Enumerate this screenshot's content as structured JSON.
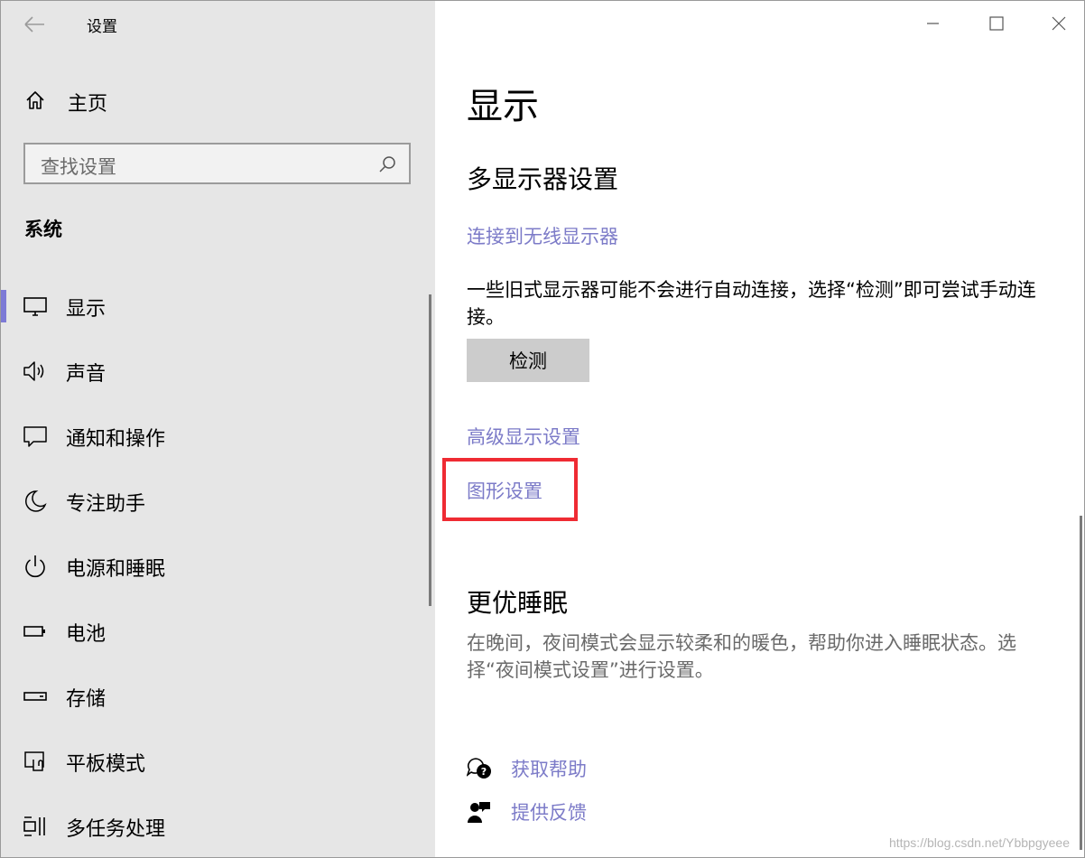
{
  "window": {
    "title": "设置"
  },
  "sidebar": {
    "home_label": "主页",
    "search_placeholder": "查找设置",
    "section_title": "系统",
    "items": [
      {
        "label": "显示",
        "icon": "monitor-icon",
        "active": true
      },
      {
        "label": "声音",
        "icon": "speaker-icon"
      },
      {
        "label": "通知和操作",
        "icon": "message-icon"
      },
      {
        "label": "专注助手",
        "icon": "moon-icon"
      },
      {
        "label": "电源和睡眠",
        "icon": "power-icon"
      },
      {
        "label": "电池",
        "icon": "battery-icon"
      },
      {
        "label": "存储",
        "icon": "storage-icon"
      },
      {
        "label": "平板模式",
        "icon": "tablet-mode-icon"
      },
      {
        "label": "多任务处理",
        "icon": "multitask-icon"
      }
    ]
  },
  "main": {
    "page_title": "显示",
    "multi_display": {
      "heading": "多显示器设置",
      "wireless_link": "连接到无线显示器",
      "description": "一些旧式显示器可能不会进行自动连接，选择“检测”即可尝试手动连接。",
      "detect_button": "检测"
    },
    "advanced_link": "高级显示设置",
    "graphics_link": "图形设置",
    "sleep": {
      "heading": "更优睡眠",
      "description": "在晚间，夜间模式会显示较柔和的暖色，帮助你进入睡眠状态。选择“夜间模式设置”进行设置。"
    },
    "help": {
      "get_help": "获取帮助",
      "feedback": "提供反馈"
    }
  },
  "watermark": "https://blog.csdn.net/Ybbpgyeee",
  "colors": {
    "accent": "#7d7ad6",
    "link": "#7c7bc8",
    "highlight": "#ef2b33",
    "sidebar_bg": "#e6e6e6"
  }
}
